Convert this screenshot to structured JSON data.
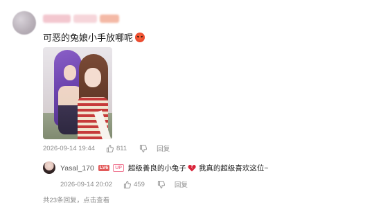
{
  "comment": {
    "text": "可恶的兔娘小手放哪呢",
    "emoji_icon": "angry-face-icon",
    "timestamp": "2026-09-14 19:44",
    "likes": "811",
    "reply_label": "回复"
  },
  "reply": {
    "username": "Yasal_170",
    "level_badge": "LV6",
    "up_badge": "UP",
    "text_before": "超级善良的小兔子",
    "heart_icon": "broken-heart-icon",
    "text_after": "我真的超级喜欢这位~",
    "timestamp": "2026-09-14 20:02",
    "likes": "459",
    "reply_label": "回复"
  },
  "footer": {
    "replies_summary": "共23条回复，点击查看"
  },
  "colors": {
    "meta_gray": "#8c8c8c",
    "lv_badge": "#e25a5a",
    "up_badge": "#f07a94"
  }
}
